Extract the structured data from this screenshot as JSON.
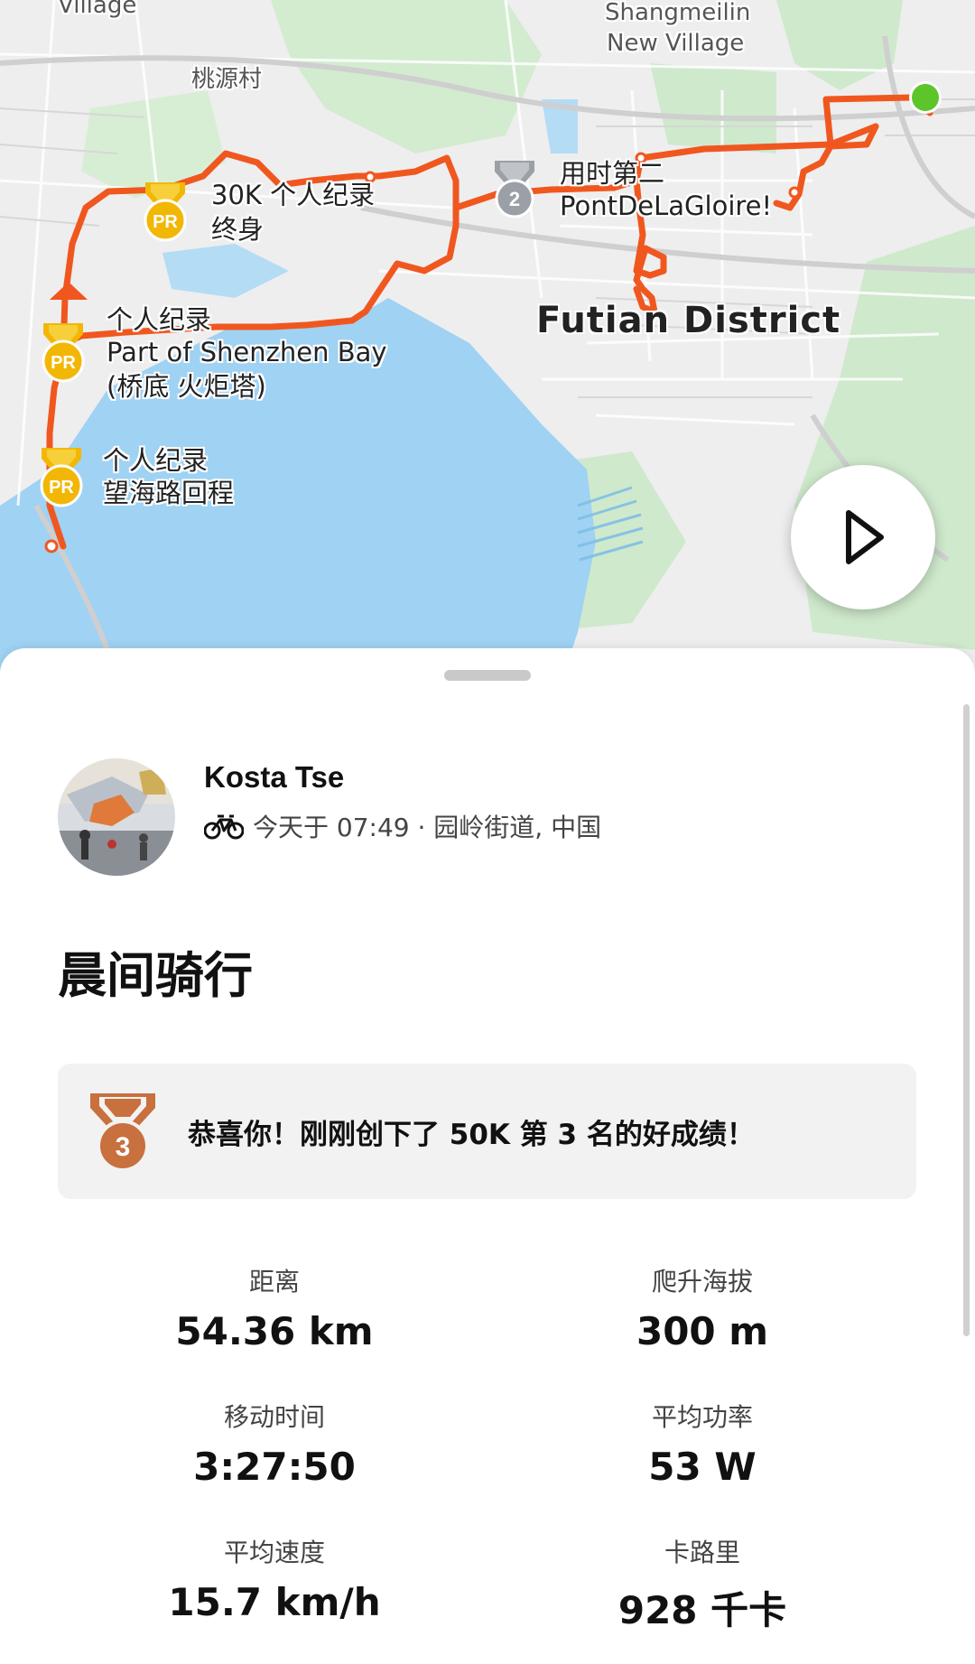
{
  "map": {
    "labels": {
      "village_partial": "Village",
      "taoyuan": "桃源村",
      "shangmeilin_1": "Shangmeilin",
      "shangmeilin_2": "New Village",
      "district": "Futian District"
    },
    "segments": {
      "seg30k_line1": "30K 个人纪录",
      "seg30k_line2": "终身",
      "segbay_line1": "个人纪录",
      "segbay_line2": "Part of Shenzhen Bay",
      "segbay_line3": "(桥底 火炬塔)",
      "segwang_line1": "个人纪录",
      "segwang_line2": "望海路回程",
      "segpont_line1": "用时第二",
      "segpont_line2": "PontDeLaGloire!"
    },
    "badges": {
      "pr": "PR",
      "rank2": "2"
    },
    "colors": {
      "route": "#f0571f",
      "water": "#9fd2f3",
      "land": "#eeeeee",
      "park": "#cfe9cc",
      "start_dot": "#5cc529"
    },
    "play_icon": "play-icon"
  },
  "activity": {
    "athlete_name": "Kosta Tse",
    "sport_icon": "bicycle-icon",
    "meta": "今天于 07:49 · 园岭街道, 中国",
    "title": "晨间骑行",
    "achievement": {
      "rank": "3",
      "text": "恭喜你！刚刚创下了 50K 第 3 名的好成绩！",
      "color": "#c8703e"
    },
    "stats": [
      {
        "label": "距离",
        "value": "54.36 km"
      },
      {
        "label": "爬升海拔",
        "value": "300 m"
      },
      {
        "label": "移动时间",
        "value": "3:27:50"
      },
      {
        "label": "平均功率",
        "value": "53 W"
      },
      {
        "label": "平均速度",
        "value": "15.7 km/h"
      },
      {
        "label": "卡路里",
        "value": "928 千卡"
      }
    ]
  }
}
